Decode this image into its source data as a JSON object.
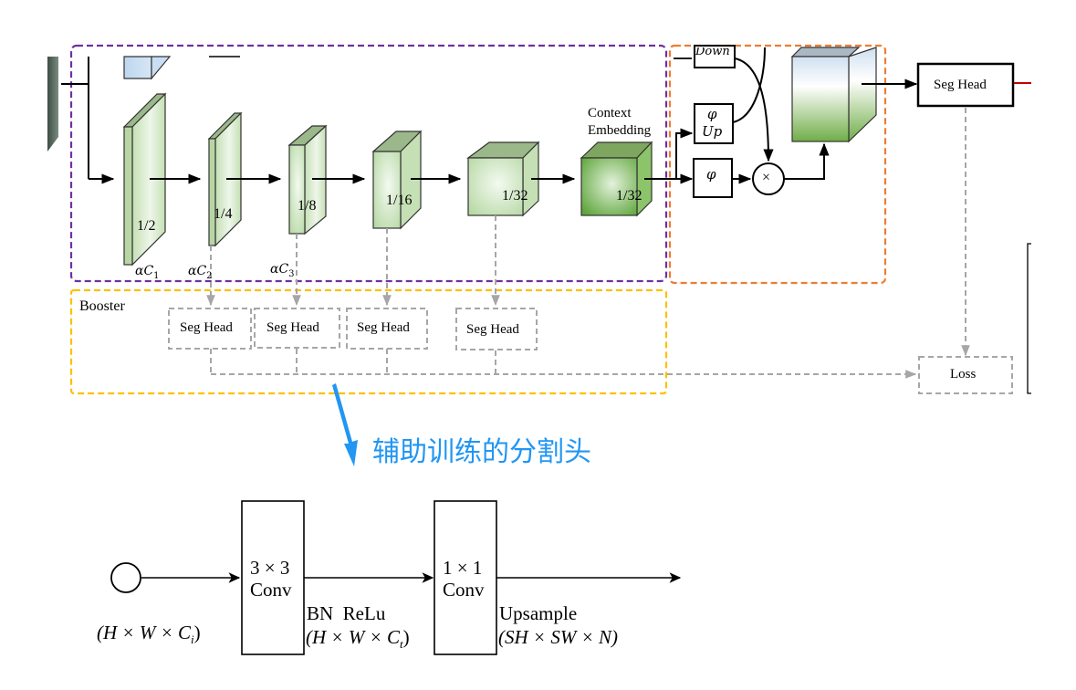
{
  "colors": {
    "backbone_border": "#7030a0",
    "aggregation_border": "#ed7d31",
    "booster_border": "#ffc000",
    "dashed_gray": "#a6a6a6",
    "annotation_blue": "#2196f3",
    "output_red": "#c00000",
    "stage_green": "#c5e0b4",
    "stage_green_dark": "#8faa7a",
    "context_green": "#70ad47"
  },
  "backbone": {
    "stages": [
      {
        "scale": "1/2",
        "channels_label": "αC",
        "channels_sub": "1"
      },
      {
        "scale": "1/4",
        "channels_label": "αC",
        "channels_sub": "2"
      },
      {
        "scale": "1/8",
        "channels_label": "αC",
        "channels_sub": "3"
      },
      {
        "scale": "1/16",
        "channels_label": "",
        "channels_sub": ""
      },
      {
        "scale": "1/32",
        "channels_label": "",
        "channels_sub": ""
      }
    ],
    "context_embedding": {
      "title_line1": "Context",
      "title_line2": "Embedding",
      "scale": "1/32"
    }
  },
  "aggregation": {
    "down_label": "Down",
    "up_phi": "φ",
    "up_label": "Up",
    "phi": "φ",
    "multiply": "×"
  },
  "main_head": {
    "label": "Seg Head"
  },
  "booster": {
    "title": "Booster",
    "heads": [
      "Seg Head",
      "Seg Head",
      "Seg Head",
      "Seg Head"
    ]
  },
  "loss": {
    "label": "Loss"
  },
  "annotation": {
    "text": "辅助训练的分割头"
  },
  "seg_head_detail": {
    "input_shape": "(H × W × C",
    "input_shape_sub": "i",
    "conv1_line1": "3 × 3",
    "conv1_line2": "Conv",
    "mid_label": "BN  ReLu",
    "mid_shape": "(H × W × C",
    "mid_shape_sub": "t",
    "conv2_line1": "1 × 1",
    "conv2_line2": "Conv",
    "out_label": "Upsample",
    "out_shape": "(SH × SW × N)"
  }
}
